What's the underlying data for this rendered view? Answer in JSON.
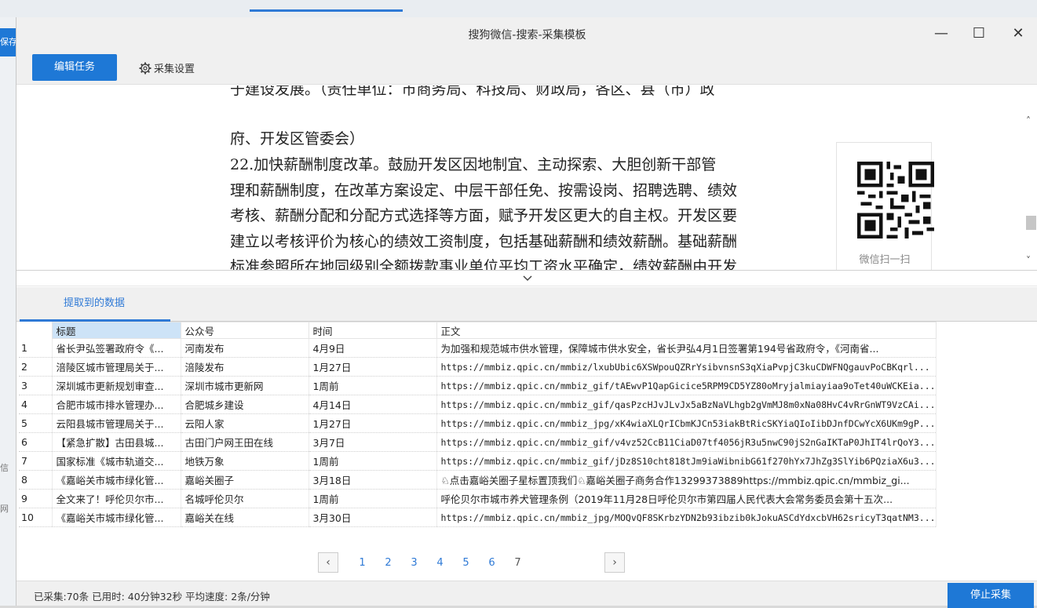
{
  "background": {
    "left_button": "保存",
    "left_label_1": "信",
    "left_label_2": "网"
  },
  "window": {
    "title": "搜狗微信-搜索-采集模板",
    "minimize": "—",
    "maximize": "☐",
    "close": "✕"
  },
  "toolbar": {
    "edit_task": "编辑任务",
    "settings": "采集设置"
  },
  "preview": {
    "lines": [
      "于建设发展。（责任单位：市商务局、科技局、财政局，各区、县（市）政",
      "府、开发区管委会）",
      "    22.加快薪酬制度改革。鼓励开发区因地制宜、主动探索、大胆创新干部管",
      "理和薪酬制度，在改革方案设定、中层干部任免、按需设岗、招聘选聘、绩效",
      "考核、薪酬分配和分配方式选择等方面，赋予开发区更大的自主权。开发区要",
      "建立以考核评价为核心的绩效工资制度，包括基础薪酬和绩效薪酬。基础薪酬",
      "标准参照所在地同级别全额拨款事业单位平均工资水平确定，绩效薪酬由开发"
    ],
    "qr_caption": "微信扫一扫"
  },
  "data_tab": "提取到的数据",
  "table": {
    "headers": [
      "标题",
      "公众号",
      "时间",
      "正文"
    ],
    "rows": [
      {
        "idx": "1",
        "title": "省长尹弘签署政府令《...",
        "account": "河南发布",
        "time": "4月9日",
        "body": "为加强和规范城市供水管理，保障城市供水安全，省长尹弘4月1日签署第194号省政府令，《河南省..."
      },
      {
        "idx": "2",
        "title": "涪陵区城市管理局关于...",
        "account": "涪陵发布",
        "time": "1月27日",
        "body": "https://mmbiz.qpic.cn/mmbiz/lxubUbic6XSWpouQZRrYsibvnsnS3qXiaPvpjC3kuCDWFNQgauvPoCBKqrl..."
      },
      {
        "idx": "3",
        "title": "深圳城市更新规划审查...",
        "account": "深圳市城市更新网",
        "time": "1周前",
        "body": "https://mmbiz.qpic.cn/mmbiz_gif/tAEwvP1QapGicice5RPM9CD5YZ80oMryjalmiayiaa9oTet40uWCKEia..."
      },
      {
        "idx": "4",
        "title": "合肥市城市排水管理办...",
        "account": "合肥城乡建设",
        "time": "4月14日",
        "body": "https://mmbiz.qpic.cn/mmbiz_gif/qasPzcHJvJLvJx5aBzNaVLhgb2gVmMJ8m0xNa08HvC4vRrGnWT9VzCAi..."
      },
      {
        "idx": "5",
        "title": "云阳县城市管理局关于...",
        "account": "云阳人家",
        "time": "1月27日",
        "body": "https://mmbiz.qpic.cn/mmbiz_jpg/xK4wiaXLQrICbmKJCn53iakBtRicSKYiaQIoIibDJnfDCwYcX6UKm9gP..."
      },
      {
        "idx": "6",
        "title": "【紧急扩散】古田县城...",
        "account": "古田门户网王田在线",
        "time": "3月7日",
        "body": "https://mmbiz.qpic.cn/mmbiz_gif/v4vz52CcB11CiaD07tf4056jR3u5nwC90jS2nGaIKTaP0JhIT4lrQoY3..."
      },
      {
        "idx": "7",
        "title": "国家标准《城市轨道交...",
        "account": "地铁万象",
        "time": "1周前",
        "body": "https://mmbiz.qpic.cn/mmbiz_gif/jDz8S10cht818tJm9iaWibnibG61f270hYx7JhZg3SlYib6PQziaX6u3..."
      },
      {
        "idx": "8",
        "title": "《嘉峪关市城市绿化管...",
        "account": "嘉峪关圈子",
        "time": "3月18日",
        "body": "♘点击嘉峪关圈子星标置顶我们♘嘉峪关圈子商务合作13299373889https://mmbiz.qpic.cn/mmbiz_gi..."
      },
      {
        "idx": "9",
        "title": "全文来了！呼伦贝尔市...",
        "account": "名城呼伦贝尔",
        "time": "1周前",
        "body": "呼伦贝尔市城市养犬管理条例（2019年11月28日呼伦贝尔市第四届人民代表大会常务委员会第十五次..."
      },
      {
        "idx": "10",
        "title": "《嘉峪关市城市绿化管...",
        "account": "嘉峪关在线",
        "time": "3月30日",
        "body": "https://mmbiz.qpic.cn/mmbiz_jpg/MOQvQF8SKrbzYDN2b93ibzib0kJokuASCdYdxcbVH62sricyT3qatNM3..."
      }
    ]
  },
  "pager": {
    "prev": "‹",
    "next": "›",
    "pages": [
      "1",
      "2",
      "3",
      "4",
      "5",
      "6",
      "7"
    ]
  },
  "status": {
    "text": "已采集:70条  已用时: 40分钟32秒  平均速度: 2条/分钟",
    "stop": "停止采集"
  },
  "colors": {
    "accent": "#1e78d6",
    "tab_blue": "#2f7ad6",
    "header_selected": "#cde3f7"
  }
}
